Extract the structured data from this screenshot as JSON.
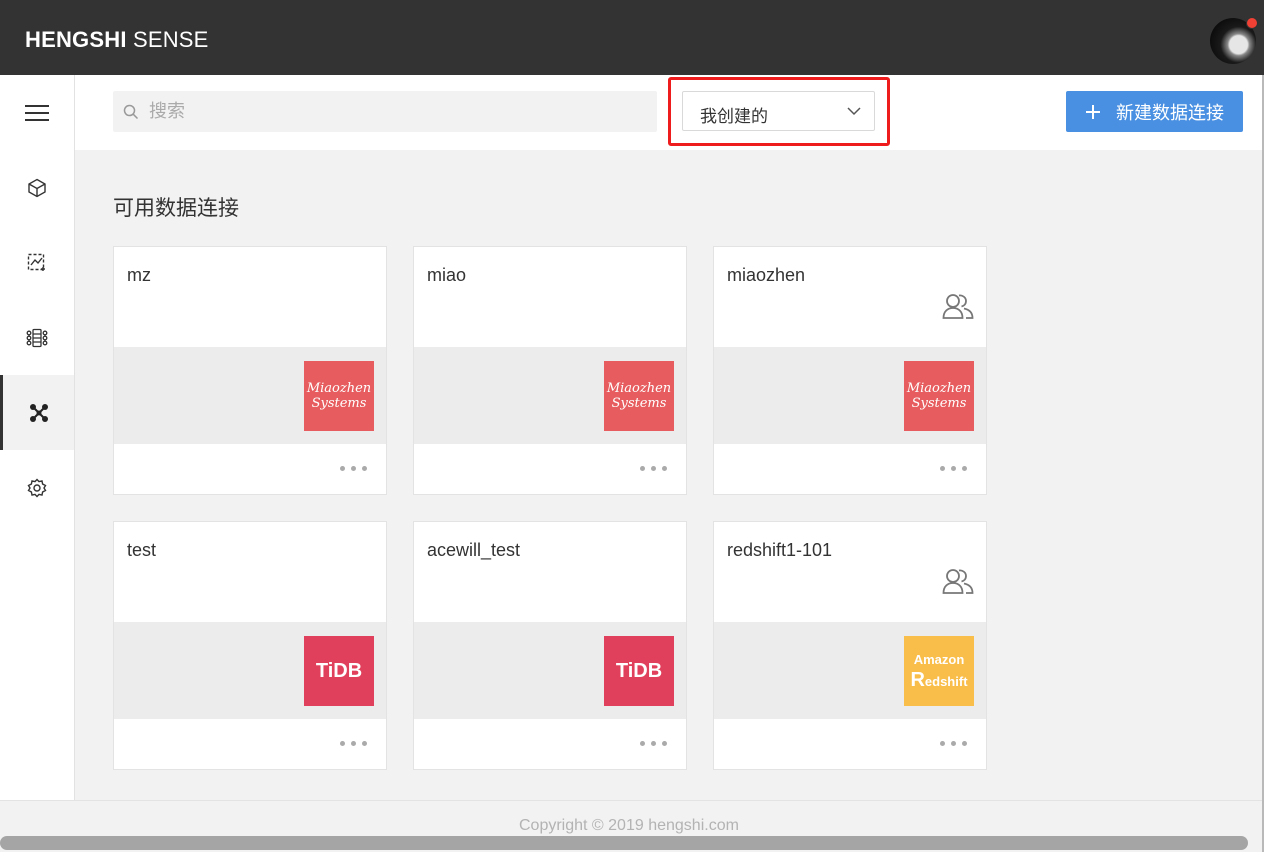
{
  "app": {
    "brand_bold": "HENGSHI",
    "brand_rest": " SENSE"
  },
  "toolbar": {
    "search_placeholder": "搜索",
    "filter_selected": "我创建的",
    "new_button_label": "新建数据连接"
  },
  "sidebar": {
    "items": [
      {
        "icon": "hamburger-menu-icon"
      },
      {
        "icon": "cube-icon"
      },
      {
        "icon": "chart-icon"
      },
      {
        "icon": "dataset-icon"
      },
      {
        "icon": "data-connection-icon",
        "active": true
      },
      {
        "icon": "gear-icon"
      }
    ]
  },
  "main": {
    "section_title": "可用数据连接",
    "cards": [
      {
        "name": "mz",
        "logo": "miaozhen",
        "shared": false
      },
      {
        "name": "miao",
        "logo": "miaozhen",
        "shared": false
      },
      {
        "name": "miaozhen",
        "logo": "miaozhen",
        "shared": true
      },
      {
        "name": "test",
        "logo": "tidb",
        "shared": false
      },
      {
        "name": "acewill_test",
        "logo": "tidb",
        "shared": false
      },
      {
        "name": "redshift1-101",
        "logo": "redshift",
        "shared": true
      }
    ]
  },
  "logos": {
    "miaozhen": {
      "line1": "Miaozhen",
      "line2": "Systems",
      "color": "#e75c5e"
    },
    "tidb": {
      "text": "TiDB",
      "color": "#e0405c"
    },
    "redshift": {
      "line1": "Amazon",
      "line2_big": "R",
      "line2_rest": "edshift",
      "color": "#f9bd4a"
    }
  },
  "footer": {
    "copyright": "Copyright © 2019 hengshi.com"
  },
  "colors": {
    "topbar": "#333333",
    "accent": "#4a90e2",
    "highlight": "#ee1c1c"
  }
}
